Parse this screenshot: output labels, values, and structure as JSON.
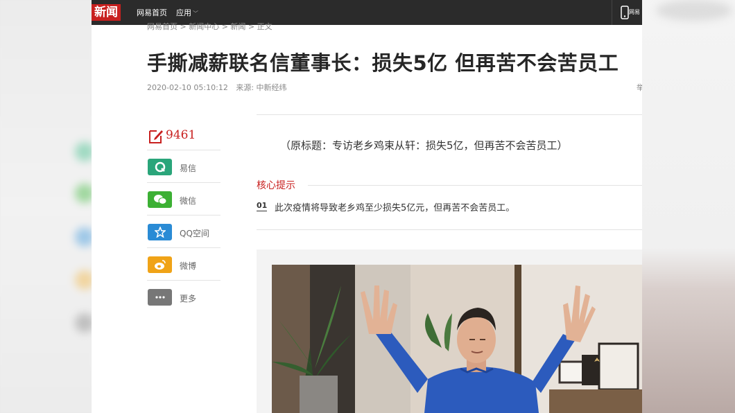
{
  "header": {
    "logo": "新闻",
    "nav_home": "网易首页",
    "nav_apps": "应用",
    "mobile_label": "网易"
  },
  "breadcrumb": "网易首页 > 新闻中心 > 新闻 > 正文",
  "article": {
    "title": "手撕减薪联名信董事长：损失5亿 但再苦不会苦员工",
    "timestamp": "2020-02-10 05:10:12",
    "source": "来源: 中新经纬",
    "meta_right": "举",
    "original_title": "（原标题：专访老乡鸡束从轩：损失5亿，但再苦不会苦员工）",
    "core_label": "核心提示",
    "core_items": [
      {
        "num": "01",
        "text": "此次疫情将导致老乡鸡至少损失5亿元，但再苦不会苦员工。"
      }
    ]
  },
  "share": {
    "comment_count": "9461",
    "items": [
      {
        "label": "易信",
        "icon": "yixin-icon",
        "color": "#2aa57a"
      },
      {
        "label": "微信",
        "icon": "wechat-icon",
        "color": "#3cb034"
      },
      {
        "label": "QQ空间",
        "icon": "qzone-icon",
        "color": "#2a8bd5"
      },
      {
        "label": "微博",
        "icon": "weibo-icon",
        "color": "#f0a317"
      },
      {
        "label": "更多",
        "icon": "more-icon",
        "color": "#777777"
      }
    ]
  },
  "colors": {
    "accent": "#c8201f",
    "topbar": "#2b2b2b"
  }
}
